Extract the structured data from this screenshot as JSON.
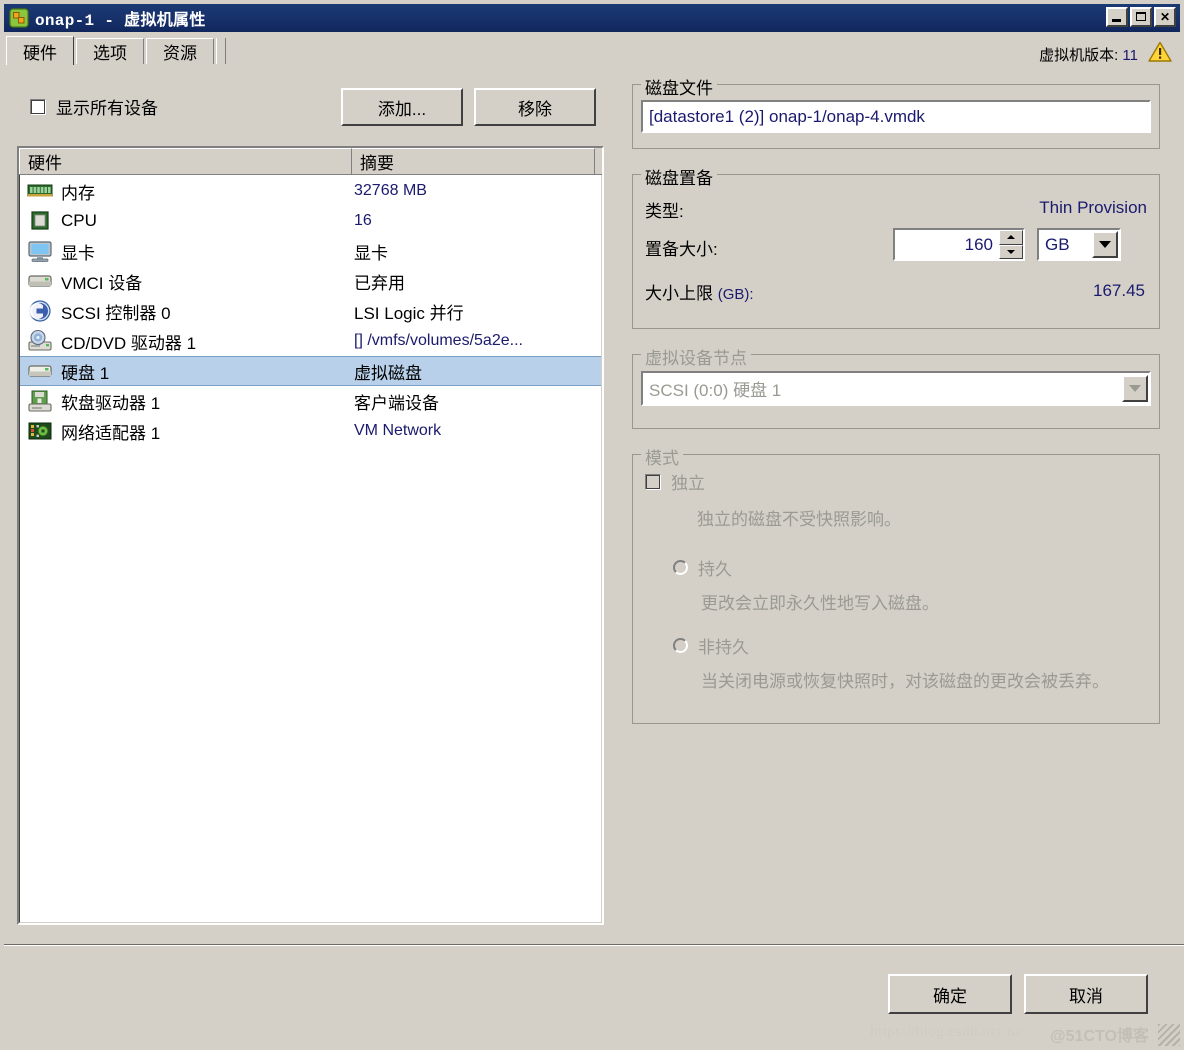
{
  "window": {
    "title_name": "onap-1",
    "title_sep": "-",
    "title_kind": "虚拟机属性",
    "icon": "vm-properties-icon",
    "buttons": {
      "minimize": "minimize-button",
      "maximize": "maximize-button",
      "close_label": "✕"
    }
  },
  "tabs": [
    {
      "label": "硬件",
      "active": true
    },
    {
      "label": "选项",
      "active": false
    },
    {
      "label": "资源",
      "active": false
    }
  ],
  "header": {
    "vm_version_label": "虚拟机版本:",
    "vm_version_value": "11",
    "warning_icon": "warning-triangle-icon"
  },
  "toolbar": {
    "show_all_devices_label": "显示所有设备",
    "show_all_devices_checked": false,
    "add_label": "添加...",
    "remove_label": "移除"
  },
  "hardware_list": {
    "columns": [
      "硬件",
      "摘要"
    ],
    "rows": [
      {
        "icon": "memory-icon",
        "name": "内存",
        "summary": "32768 MB",
        "summary_cn": false,
        "selected": false
      },
      {
        "icon": "cpu-icon",
        "name": "CPU",
        "summary": "16",
        "summary_cn": false,
        "selected": false
      },
      {
        "icon": "video-card-icon",
        "name": "显卡",
        "summary": "显卡",
        "summary_cn": true,
        "selected": false
      },
      {
        "icon": "vmci-device-icon",
        "name": "VMCI 设备",
        "summary": "已弃用",
        "summary_cn": true,
        "selected": false
      },
      {
        "icon": "scsi-controller-icon",
        "name": "SCSI 控制器  0",
        "summary": "LSI Logic 并行",
        "summary_cn": true,
        "selected": false
      },
      {
        "icon": "cd-dvd-drive-icon",
        "name": "CD/DVD 驱动器  1",
        "summary": "[] /vmfs/volumes/5a2e...",
        "summary_cn": false,
        "selected": false
      },
      {
        "icon": "hard-disk-icon",
        "name": "硬盘  1",
        "summary": "虚拟磁盘",
        "summary_cn": true,
        "selected": true
      },
      {
        "icon": "floppy-drive-icon",
        "name": "软盘驱动器  1",
        "summary": "客户端设备",
        "summary_cn": true,
        "selected": false
      },
      {
        "icon": "network-adapter-icon",
        "name": "网络适配器  1",
        "summary": "VM Network",
        "summary_cn": false,
        "selected": false
      }
    ]
  },
  "disk_file": {
    "group_label": "磁盘文件",
    "value": "[datastore1 (2)] onap-1/onap-4.vmdk"
  },
  "disk_provisioning": {
    "group_label": "磁盘置备",
    "type_label": "类型:",
    "type_value": "Thin Provision",
    "prov_size_label": "置备大小:",
    "prov_size_value": "160",
    "prov_size_unit": "GB",
    "max_size_label": "大小上限",
    "max_size_unit_label": "(GB):",
    "max_size_value": "167.45"
  },
  "virtual_device_node": {
    "group_label": "虚拟设备节点",
    "selected": "SCSI (0:0) 硬盘  1",
    "disabled": true
  },
  "mode": {
    "group_label": "模式",
    "independent_label": "独立",
    "independent_checked": false,
    "independent_desc": "独立的磁盘不受快照影响。",
    "persistent_label": "持久",
    "persistent_desc": "更改会立即永久性地写入磁盘。",
    "nonpersistent_label": "非持久",
    "nonpersistent_desc": "当关闭电源或恢复快照时，对该磁盘的更改会被丢弃。",
    "disabled": true
  },
  "footer": {
    "ok_label": "确定",
    "cancel_label": "取消"
  },
  "watermark": {
    "url": "https://blog.csdn.net/na",
    "overlay": "@51CTO博客"
  },
  "colors": {
    "titlebar": "#16316b",
    "face": "#d4d0c8",
    "selection": "#b8d0ea",
    "value_text": "#1a1a6e",
    "disabled_text": "#9a9a92"
  }
}
